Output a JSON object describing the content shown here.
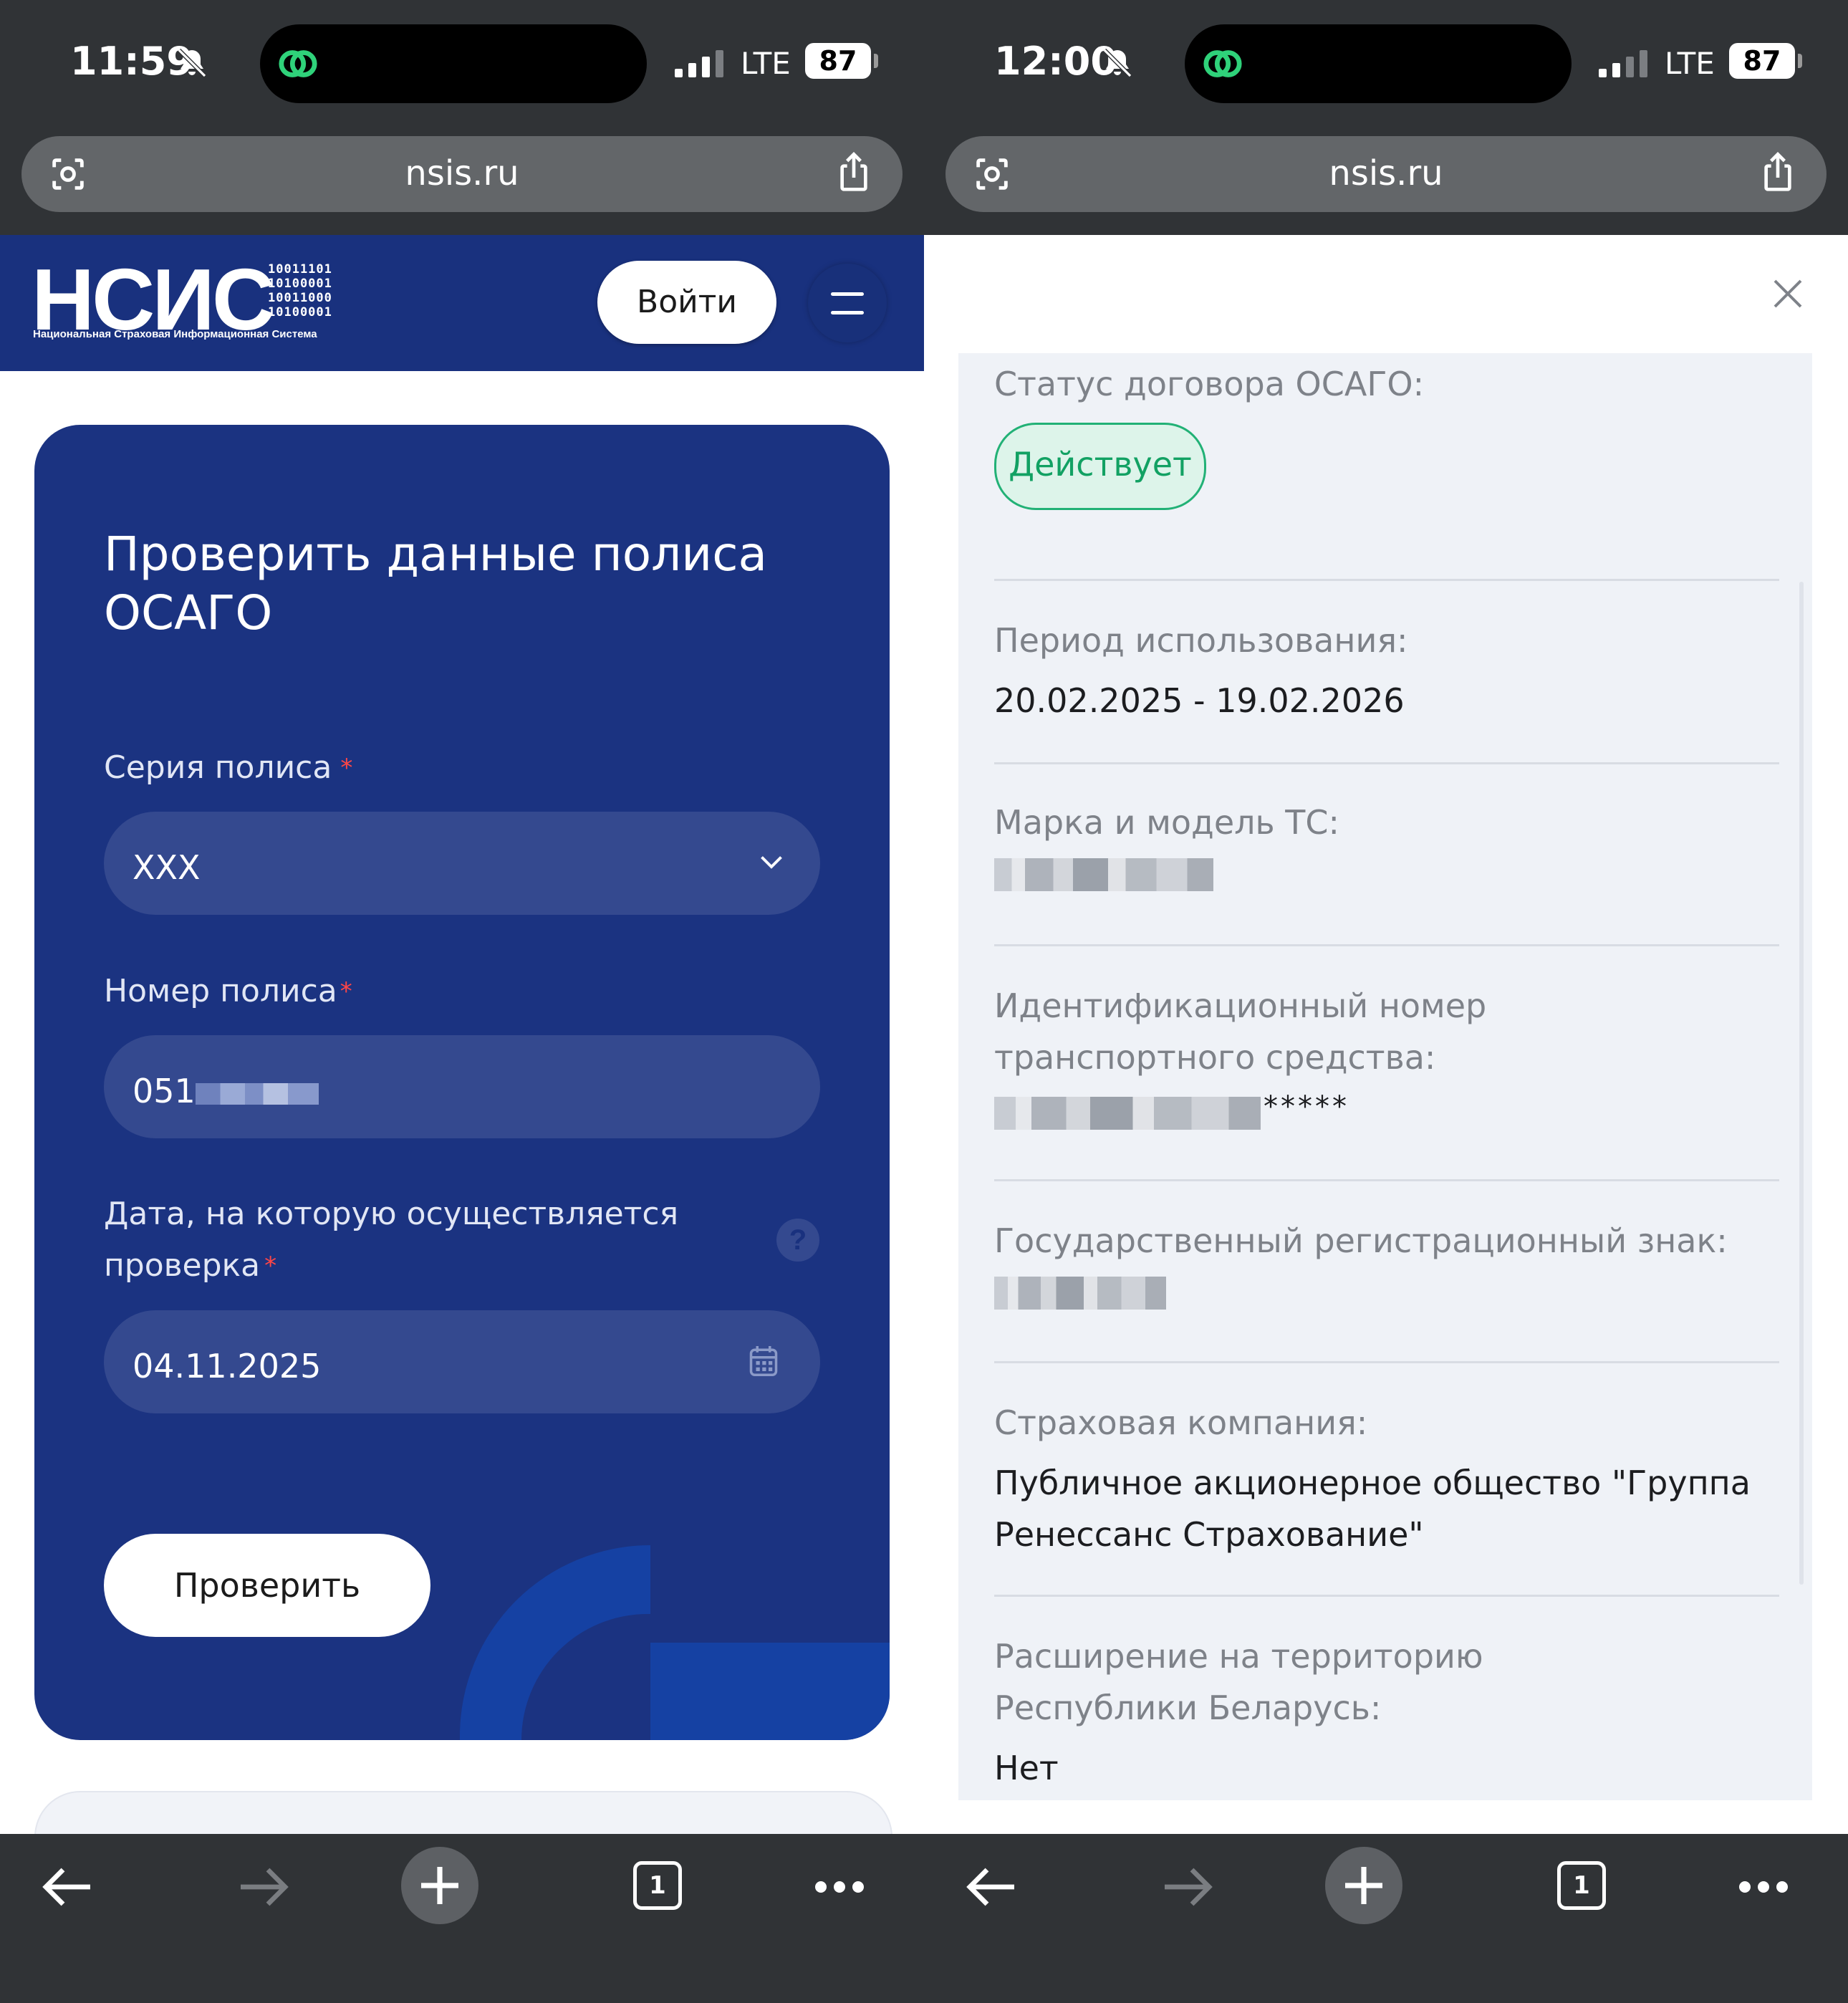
{
  "left": {
    "status": {
      "time": "11:59",
      "network": "LTE",
      "battery": "87"
    },
    "browser": {
      "url": "nsis.ru"
    },
    "site_header": {
      "logo_text": "НСИС",
      "logo_binary": [
        "10011101",
        "10100001",
        "10011000",
        "10100001"
      ],
      "logo_subtitle": "Национальная Страховая Информационная Система",
      "login_label": "Войти"
    },
    "form": {
      "title": "Проверить данные полиса ОСАГО",
      "series_label": "Серия полиса",
      "series_value": "XXX",
      "number_label": "Номер полиса",
      "number_value": "051",
      "date_label": "Дата, на которую осуществляется проверка",
      "date_value": "04.11.2025",
      "help_glyph": "?",
      "required_mark": "*",
      "submit_label": "Проверить"
    },
    "toolbar": {
      "tabs_count": "1"
    }
  },
  "right": {
    "status": {
      "time": "12:00",
      "network": "LTE",
      "battery": "87"
    },
    "browser": {
      "url": "nsis.ru"
    },
    "result": {
      "status_label": "Статус договора ОСАГО:",
      "status_value": "Действует",
      "period_label": "Период использования:",
      "period_value": "20.02.2025 - 19.02.2026",
      "model_label": "Марка и модель ТС:",
      "vin_label": "Идентификационный номер транспортного средства:",
      "vin_suffix": "*****",
      "plate_label": "Государственный регистрационный знак:",
      "insurer_label": "Страховая компания:",
      "insurer_value": "Публичное акционерное общество \"Группа Ренессанс Страхование\"",
      "belarus_label": "Расширение на территорию Республики Беларусь:",
      "belarus_value": "Нет"
    },
    "toolbar": {
      "tabs_count": "1"
    }
  },
  "colors": {
    "brand_blue": "#19317e",
    "status_green": "#12a163",
    "browser_chrome": "#303336"
  },
  "icons": [
    "bell-off-icon",
    "island-app-icon",
    "signal-icon",
    "lens-icon",
    "share-icon",
    "chevron-down-icon",
    "calendar-icon",
    "help-icon",
    "close-icon",
    "back-icon",
    "forward-icon",
    "plus-icon",
    "tabs-icon",
    "more-icon"
  ]
}
